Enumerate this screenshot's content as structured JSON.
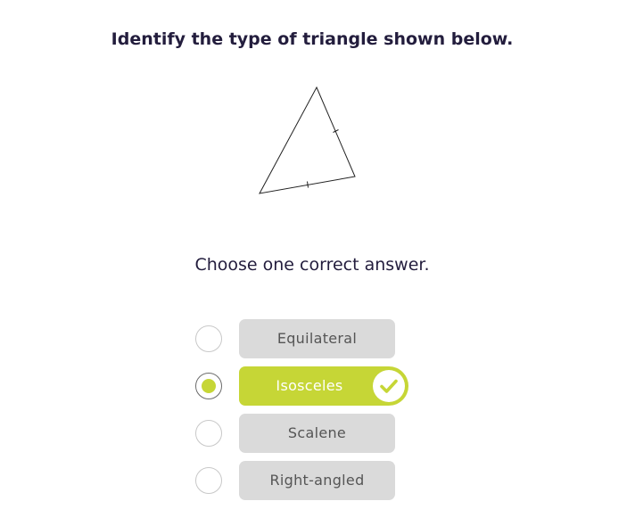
{
  "question": {
    "title": "Identify the type of triangle shown below."
  },
  "figure": {
    "icon": "triangle-with-tick-marks"
  },
  "prompt": "Choose one correct answer.",
  "options": [
    {
      "label": "Equilateral",
      "selected": false,
      "correct": false
    },
    {
      "label": "Isosceles",
      "selected": true,
      "correct": true
    },
    {
      "label": "Scalene",
      "selected": false,
      "correct": false
    },
    {
      "label": "Right-angled",
      "selected": false,
      "correct": false
    }
  ],
  "colors": {
    "accent": "#c6d636",
    "option_bg": "#dadada",
    "option_text": "#555555",
    "heading_text": "#231d3d"
  }
}
